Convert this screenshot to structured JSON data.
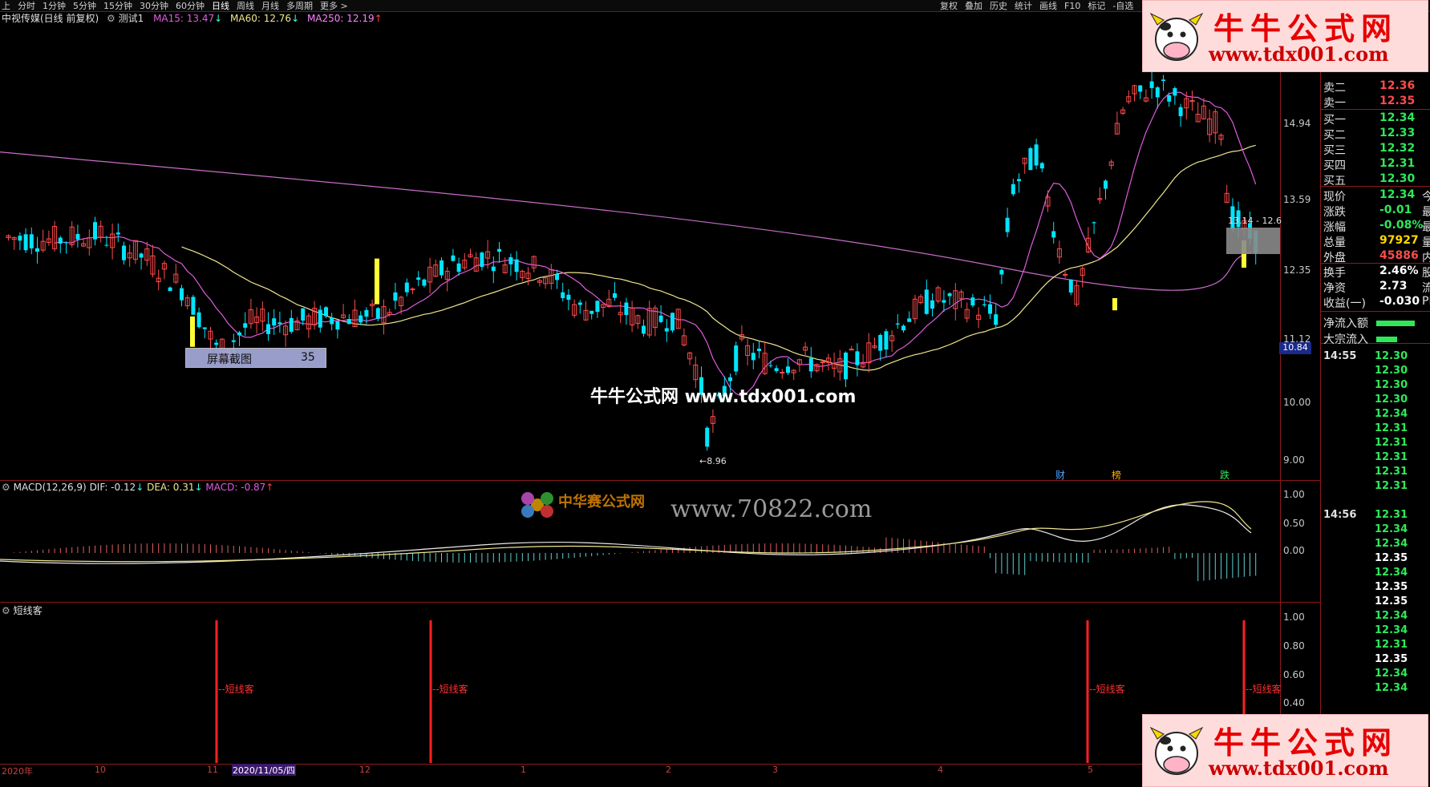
{
  "topbar": {
    "left": [
      "上",
      "分时",
      "1分钟",
      "5分钟",
      "15分钟",
      "30分钟",
      "60分钟",
      "日线",
      "周线",
      "月线",
      "多周期",
      "更多 >"
    ],
    "selected": "日线",
    "right": [
      "复权",
      "叠加",
      "历史",
      "统计",
      "画线",
      "F10",
      "标记",
      "-自选"
    ]
  },
  "title": {
    "name": "中视传媒(日线 前复权)",
    "test": "测试1",
    "ma15": "MA15: 13.47",
    "ma60": "MA60: 12.76",
    "ma250": "MA250: 12.19"
  },
  "price_axis": [
    "14.94",
    "13.59",
    "12.35",
    "11.12",
    "10.00",
    "9.00"
  ],
  "price_badge": "10.84",
  "range_label": "13.14 - 12.6",
  "low_label": "8.96",
  "screenshot_tip": {
    "label": "屏幕截图",
    "num": "35"
  },
  "event_markers": [
    "财",
    "榜",
    "跌"
  ],
  "macd": {
    "title": "MACD(12,26,9)",
    "dif": "DIF: -0.12",
    "dea": "DEA: 0.31",
    "macd": "MACD: -0.87",
    "axis": [
      "1.00",
      "0.50",
      "0.00"
    ]
  },
  "indicator": {
    "title": "短线客",
    "axis": [
      "1.00",
      "0.80",
      "0.60",
      "0.40"
    ],
    "signal_label": "短线客"
  },
  "time_axis": {
    "year": "2020年",
    "months": [
      "10",
      "11",
      "12",
      "1",
      "2",
      "3",
      "4",
      "5"
    ],
    "cursor_date": "2020/11/05/四"
  },
  "orderbook": {
    "sells": [
      {
        "label": "卖二",
        "value": "12.36"
      },
      {
        "label": "卖一",
        "value": "12.35"
      }
    ],
    "buys": [
      {
        "label": "买一",
        "value": "12.34"
      },
      {
        "label": "买二",
        "value": "12.33"
      },
      {
        "label": "买三",
        "value": "12.32"
      },
      {
        "label": "买四",
        "value": "12.31"
      },
      {
        "label": "买五",
        "value": "12.30"
      }
    ],
    "stats": [
      {
        "label": "现价",
        "value": "12.34",
        "extra": "今",
        "color": "green"
      },
      {
        "label": "涨跌",
        "value": "-0.01",
        "extra": "最",
        "color": "green"
      },
      {
        "label": "涨幅",
        "value": "-0.08%",
        "extra": "最",
        "color": "green"
      },
      {
        "label": "总量",
        "value": "97927",
        "extra": "量",
        "color": "yellow"
      },
      {
        "label": "外盘",
        "value": "45886",
        "extra": "内",
        "color": "red"
      },
      {
        "label": "换手",
        "value": "2.46%",
        "extra": "股",
        "color": "white"
      },
      {
        "label": "净资",
        "value": "2.73",
        "extra": "流",
        "color": "white"
      },
      {
        "label": "收益(一)",
        "value": "-0.030",
        "extra": "PI",
        "color": "white"
      }
    ],
    "flows": [
      {
        "label": "净流入额"
      },
      {
        "label": "大宗流入"
      }
    ]
  },
  "ticks": {
    "t1": "14:55",
    "t1_values": [
      "12.30",
      "12.30",
      "12.30",
      "12.30",
      "12.34",
      "12.31",
      "12.31",
      "12.31",
      "12.31",
      "12.31"
    ],
    "t2": "14:56",
    "t2_values": [
      "12.31",
      "12.34",
      "12.34",
      "12.35",
      "12.34",
      "12.35",
      "12.35",
      "12.34",
      "12.34",
      "12.31",
      "12.35",
      "12.34",
      "12.34"
    ]
  },
  "watermarks": {
    "center": "牛牛公式网 www.tdx001.com",
    "macd_wm": "www.70822.com",
    "macd_logo": "中华赛公式网"
  },
  "logos": {
    "text1": "牛牛公式网",
    "text2": "www.tdx001.com"
  },
  "colors": {
    "up": "#ff4b4b",
    "down": "#00e5ff",
    "ma15": "#e05be0",
    "ma60": "#f0e68c",
    "ma250": "#c86dc8",
    "grid": "#8b1a1a"
  }
}
